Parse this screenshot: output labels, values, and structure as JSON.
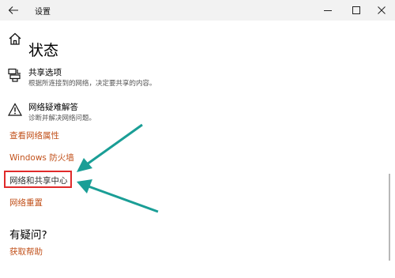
{
  "window": {
    "title": "设置"
  },
  "header": {
    "title": "状态"
  },
  "items": [
    {
      "title": "共享选项",
      "desc": "根据所连接到的网络，决定要共享的内容。"
    },
    {
      "title": "网络疑难解答",
      "desc": "诊断并解决网络问题。"
    }
  ],
  "links": {
    "view_properties": "查看网络属性",
    "firewall": "Windows 防火墙",
    "sharing_center": "网络和共享中心",
    "reset": "网络重置",
    "help": "获取帮助"
  },
  "faq": {
    "title": "有疑问?"
  },
  "colors": {
    "accent": "#c2521c",
    "highlight": "#e02a2a",
    "arrow": "#1a9e96"
  },
  "icons": {
    "back": "back-arrow-icon",
    "home": "home-icon",
    "sharing": "sharing-options-icon",
    "troubleshoot": "warning-icon"
  }
}
